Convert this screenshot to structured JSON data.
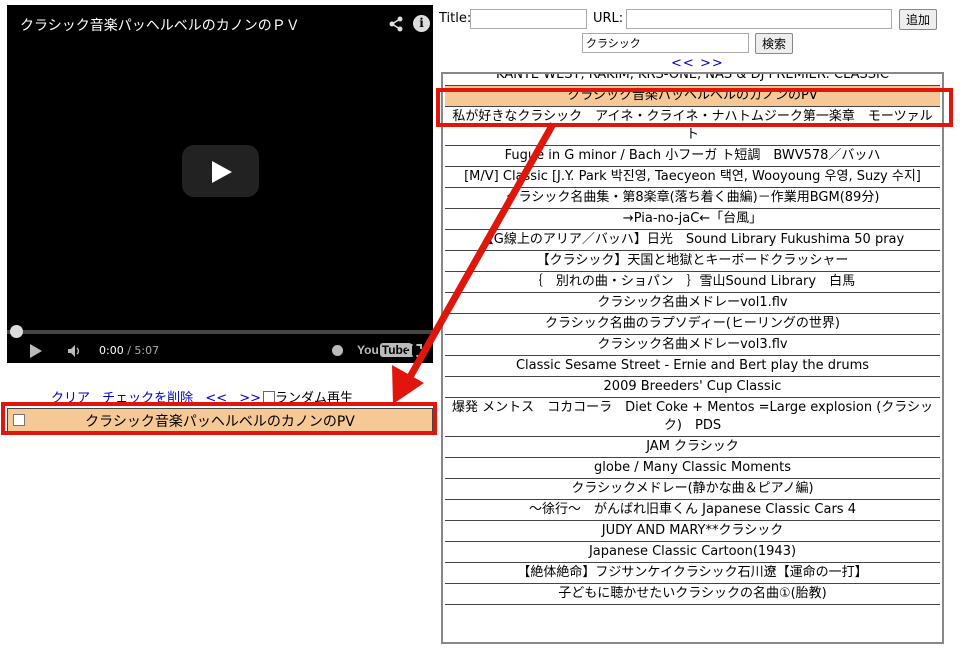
{
  "player": {
    "title": "クラシック音楽パッヘルベルのカノンのＰＶ",
    "time_current": "0:00",
    "time_total": "/ 5:07",
    "logo_text": "You",
    "logo_tube": "Tube"
  },
  "form": {
    "title_label": "Title:",
    "title_value": "",
    "url_label": "URL:",
    "url_value": "",
    "add_button": "追加",
    "search_value": "クラシック",
    "search_button": "検索",
    "nav_prev": "<<",
    "nav_next": ">>"
  },
  "playlist": {
    "clear": "クリア",
    "delete_checked": "チェックを削除",
    "prev": "<<",
    "next": ">>",
    "random_label": "ランダム再生",
    "item": "クラシック音楽パッヘルベルのカノンのPV"
  },
  "results": [
    "KANYE WEST, RAKIM, KRS-ONE, NAS & DJ PREMIER: CLASSIC",
    "クラシック音楽パッヘルベルのカノンのPV",
    "私が好きなクラシック　アイネ・クライネ・ナハトムジーク第一楽章　モーツァルト",
    "Fugue in G minor / Bach 小フーガ ト短調　BWV578／バッハ",
    "[M/V] Classic [J.Y. Park 박진영, Taecyeon 택연, Wooyoung 우영, Suzy 수지]",
    "クラシック名曲集・第8楽章(落ち着く曲編)－作業用BGM(89分)",
    "→Pia-no-jaC←「台風」",
    "【G線上のアリア／バッハ】日光　Sound Library Fukushima 50 pray",
    "【クラシック】天国と地獄とキーボードクラッシャー",
    "｛　別れの曲・ショパン　｝雪山Sound Library　白馬",
    "クラシック名曲メドレーvol1.flv",
    "クラシック名曲のラプソディー(ヒーリングの世界)",
    "クラシック名曲メドレーvol3.flv",
    "Classic Sesame Street - Ernie and Bert play the drums",
    "2009 Breeders' Cup Classic",
    "爆発 メントス　コカコーラ　Diet Coke + Mentos =Large explosion (クラシック)　PDS",
    "JAM クラシック",
    "globe / Many Classic Moments",
    "クラシックメドレー(静かな曲＆ピアノ編)",
    "～徐行～　がんばれ旧車くん Japanese Classic Cars 4",
    "JUDY AND MARY**クラシック",
    "Japanese Classic Cartoon(1943)",
    "【絶体絶命】フジサンケイクラシック石川遼【運命の一打】",
    "子どもに聴かせたいクラシックの名曲①(胎教)"
  ],
  "selected_index": 1,
  "colors": {
    "highlight": "#f5c896",
    "annotation": "#e0150c",
    "link": "#0000cc"
  }
}
